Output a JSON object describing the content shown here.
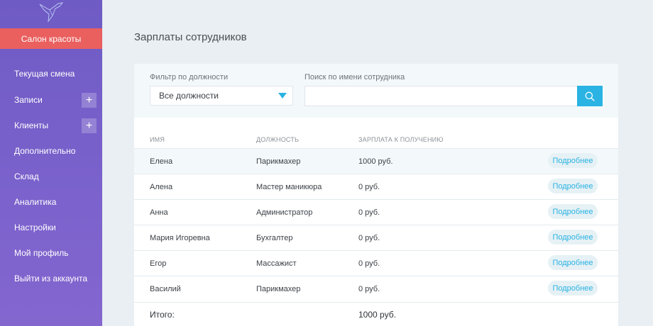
{
  "sidebar": {
    "brand_button": "Салон красоты",
    "items": [
      {
        "label": "Текущая смена",
        "has_add": false
      },
      {
        "label": "Записи",
        "has_add": true
      },
      {
        "label": "Клиенты",
        "has_add": true
      },
      {
        "label": "Дополнительно",
        "has_add": false
      },
      {
        "label": "Склад",
        "has_add": false
      },
      {
        "label": "Аналитика",
        "has_add": false
      },
      {
        "label": "Настройки",
        "has_add": false
      },
      {
        "label": "Мой профиль",
        "has_add": false
      },
      {
        "label": "Выйти из аккаунта",
        "has_add": false
      }
    ],
    "add_symbol": "+"
  },
  "main": {
    "title": "Зарплаты сотрудников",
    "filter": {
      "position_label": "Фильтр по должности",
      "position_value": "Все должности",
      "search_label": "Поиск по имени сотрудника",
      "search_value": "",
      "search_placeholder": ""
    },
    "table": {
      "columns": [
        "Имя",
        "Должность",
        "Зарплата к получению"
      ],
      "rows": [
        {
          "name": "Елена",
          "position": "Парикмахер",
          "salary": "1000 руб.",
          "action": "Подробнее"
        },
        {
          "name": "Алена",
          "position": "Мастер маникюра",
          "salary": "0 руб.",
          "action": "Подробнее"
        },
        {
          "name": "Анна",
          "position": "Администратор",
          "salary": "0 руб.",
          "action": "Подробнее"
        },
        {
          "name": "Мария Игоревна",
          "position": "Бухгалтер",
          "salary": "0 руб.",
          "action": "Подробнее"
        },
        {
          "name": "Егор",
          "position": "Массажист",
          "salary": "0 руб.",
          "action": "Подробнее"
        },
        {
          "name": "Василий",
          "position": "Парикмахер",
          "salary": "0 руб.",
          "action": "Подробнее"
        }
      ],
      "total_label": "Итого:",
      "total_value": "1000 руб."
    }
  },
  "colors": {
    "sidebar": "#7b62cc",
    "brand_button": "#e9605f",
    "accent": "#2ab3e3"
  }
}
